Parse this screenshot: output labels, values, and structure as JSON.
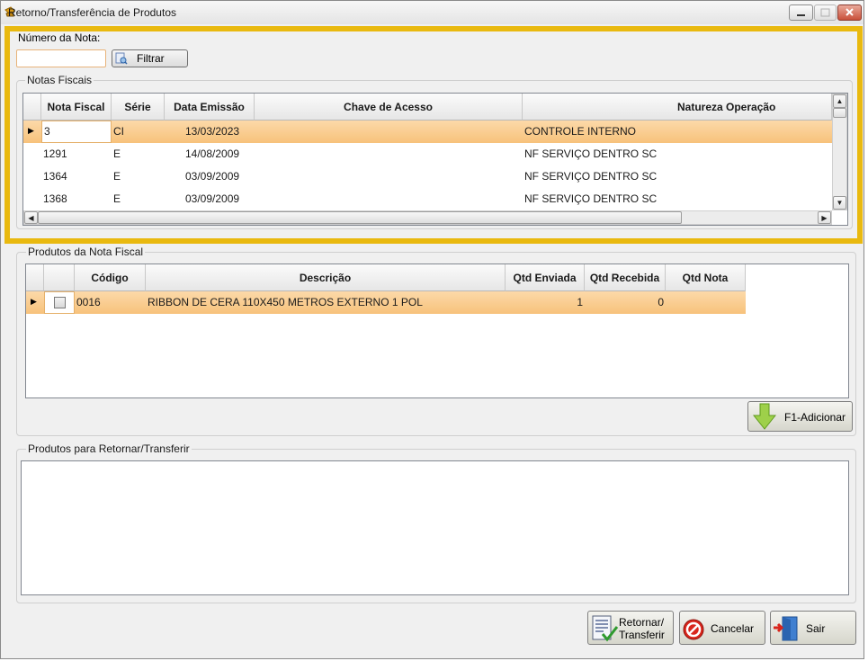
{
  "window": {
    "title": "Retorno/Transferência de Produtos"
  },
  "filter": {
    "label": "Número da Nota:",
    "value": "",
    "button_label": "Filtrar"
  },
  "notas": {
    "group_title": "Notas Fiscais",
    "columns": [
      "Nota Fiscal",
      "Série",
      "Data Emissão",
      "Chave de Acesso",
      "Natureza Operação"
    ],
    "rows": [
      {
        "nota": "3",
        "serie": "CI",
        "data": "13/03/2023",
        "chave": "",
        "natureza": "CONTROLE INTERNO",
        "selected": true
      },
      {
        "nota": "1291",
        "serie": "E",
        "data": "14/08/2009",
        "chave": "",
        "natureza": "NF SERVIÇO DENTRO SC"
      },
      {
        "nota": "1364",
        "serie": "E",
        "data": "03/09/2009",
        "chave": "",
        "natureza": "NF SERVIÇO DENTRO SC"
      },
      {
        "nota": "1368",
        "serie": "E",
        "data": "03/09/2009",
        "chave": "",
        "natureza": "NF SERVIÇO DENTRO SC"
      }
    ]
  },
  "produtos": {
    "group_title": "Produtos da Nota Fiscal",
    "columns": [
      "Código",
      "Descrição",
      "Qtd Enviada",
      "Qtd Recebida",
      "Qtd Nota"
    ],
    "rows": [
      {
        "codigo": "0016",
        "descricao": "RIBBON DE CERA 110X450 METROS EXTERNO 1 POL",
        "enviada": "1",
        "recebida": "0",
        "nota": ""
      }
    ],
    "add_button_label": "F1-Adicionar"
  },
  "retorno": {
    "group_title": "Produtos para Retornar/Transferir"
  },
  "actions": {
    "retornar_line1": "Retornar/",
    "retornar_line2": "Transferir",
    "cancelar": "Cancelar",
    "sair": "Sair"
  },
  "colors": {
    "highlight": "#e9b90f",
    "selected_row": "#f7c27b"
  }
}
